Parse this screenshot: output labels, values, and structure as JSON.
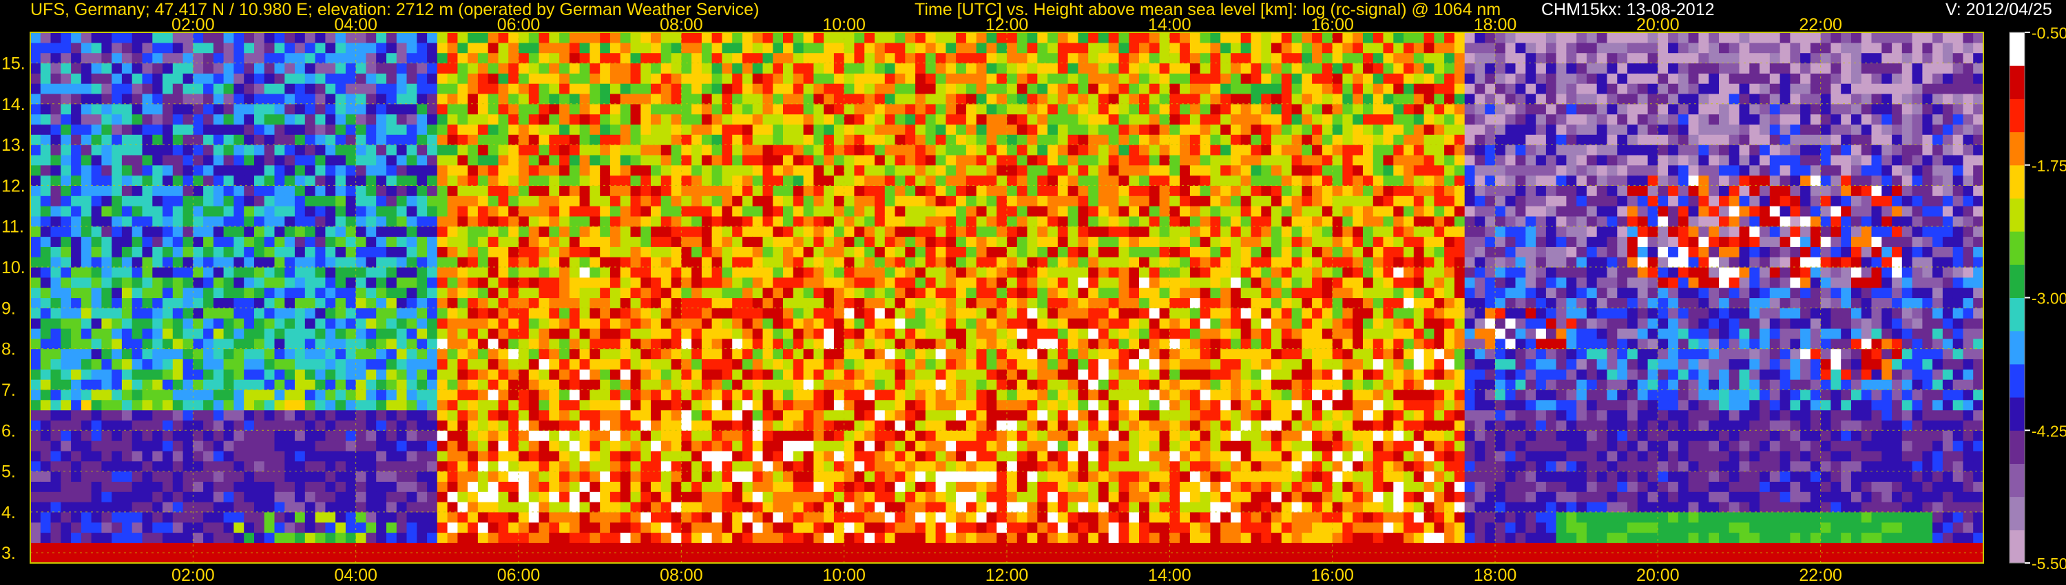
{
  "header": {
    "site": "UFS, Germany; 47.417 N / 10.980 E; elevation: 2712 m  (operated by German Weather Service)",
    "description": "Time [UTC] vs. Height above mean sea level [km]: log (rc-signal) @ 1064 nm",
    "instrument_date": "CHM15kx: 13-08-2012",
    "version": "V: 2012/04/25"
  },
  "colors": {
    "background": "#000000",
    "header_text": "#ffd800",
    "tick_label_text": "#ffd800",
    "grid": "#c8c800",
    "colormap": [
      "#c8a0c8",
      "#a080b8",
      "#8a5aa8",
      "#6a2a90",
      "#3010b0",
      "#2040ff",
      "#30a0ff",
      "#30d0c0",
      "#20b040",
      "#60d020",
      "#c0e000",
      "#ffd000",
      "#ff8000",
      "#ff2000",
      "#d00000",
      "#ffffff"
    ]
  },
  "chart_data": {
    "type": "heatmap",
    "title": "log (rc-signal) @ 1064 nm",
    "xlabel": "Time [UTC]",
    "ylabel": "Height above mean sea level [km]",
    "x_range_hours": [
      0.0,
      24.0
    ],
    "y_range_km": [
      2.75,
      15.75
    ],
    "x_ticks": [
      "02:00",
      "04:00",
      "06:00",
      "08:00",
      "10:00",
      "12:00",
      "14:00",
      "16:00",
      "18:00",
      "20:00",
      "22:00"
    ],
    "x_tick_hours": [
      2,
      4,
      6,
      8,
      10,
      12,
      14,
      16,
      18,
      20,
      22
    ],
    "y_ticks": [
      "3.",
      "4.",
      "5.",
      "6.",
      "7.",
      "8.",
      "9.",
      "10.",
      "11.",
      "12.",
      "13.",
      "14.",
      "15."
    ],
    "y_tick_km": [
      3,
      4,
      5,
      6,
      7,
      8,
      9,
      10,
      11,
      12,
      13,
      14,
      15
    ],
    "colorbar": {
      "range": [
        -5.5,
        -0.5
      ],
      "tick_labels": [
        "-0.50",
        "-1.75",
        "-3.00",
        "-4.25",
        "-5.50"
      ],
      "tick_values": [
        -0.5,
        -1.75,
        -3.0,
        -4.25,
        -5.5
      ]
    },
    "grid": true,
    "features": {
      "boundary_layer_top_km": 3.9,
      "daytime_noise_hours": [
        5.0,
        17.6
      ],
      "night_clear_hours": [
        17.6,
        24.0
      ],
      "low_cloud_layer_km": [
        3.3,
        4.0
      ],
      "low_cloud_hours": [
        18.8,
        23.4
      ],
      "cirrus_layers": [
        {
          "time_hours": [
            17.8,
            19.2
          ],
          "height_km": [
            8.0,
            8.9
          ]
        },
        {
          "time_hours": [
            19.6,
            23.0
          ],
          "height_km": [
            9.5,
            12.2
          ]
        },
        {
          "time_hours": [
            21.8,
            23.0
          ],
          "height_km": [
            7.2,
            8.2
          ]
        }
      ]
    }
  }
}
